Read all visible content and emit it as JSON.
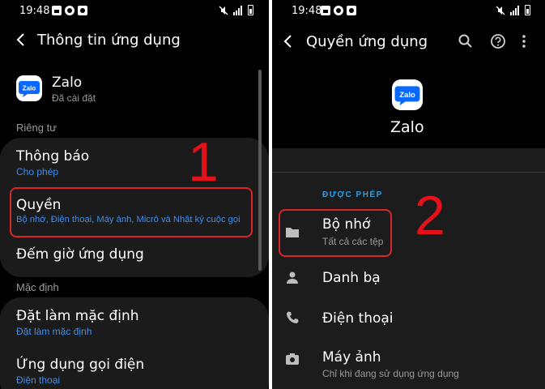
{
  "left": {
    "status": {
      "time": "19:48"
    },
    "app_bar": {
      "title": "Thông tin ứng dụng"
    },
    "app": {
      "icon_text": "Zalo",
      "name": "Zalo",
      "status": "Đã cài đặt"
    },
    "sections": {
      "privacy": "Riêng tư",
      "default": "Mặc định"
    },
    "items": {
      "notifications": {
        "title": "Thông báo",
        "subtitle": "Cho phép"
      },
      "permissions": {
        "title": "Quyền",
        "subtitle": "Bộ nhớ, Điện thoại, Máy ảnh, Micrô và Nhật ký cuộc gọi"
      },
      "screen_time": {
        "title": "Đếm giờ ứng dụng"
      },
      "set_default": {
        "title": "Đặt làm mặc định",
        "subtitle": "Đặt làm mặc định"
      },
      "call_app": {
        "title": "Ứng dụng gọi điện",
        "subtitle": "Điện thoại"
      }
    },
    "step_label": "1"
  },
  "right": {
    "status": {
      "time": "19:48"
    },
    "app_bar": {
      "title": "Quyền ứng dụng"
    },
    "app": {
      "icon_text": "Zalo",
      "name": "Zalo"
    },
    "allowed_header": "ĐƯỢC PHÉP",
    "permissions": [
      {
        "name": "Bộ nhớ",
        "detail": "Tất cả các tệp",
        "icon": "folder-icon"
      },
      {
        "name": "Danh bạ",
        "detail": "",
        "icon": "person-icon"
      },
      {
        "name": "Điện thoại",
        "detail": "",
        "icon": "phone-icon"
      },
      {
        "name": "Máy ảnh",
        "detail": "Chỉ khi đang sử dụng ứng dụng",
        "icon": "camera-icon"
      }
    ],
    "step_label": "2"
  },
  "colors": {
    "accent_blue": "#3d8ef0",
    "highlight_red": "#d8262c",
    "step_red": "#e4111a",
    "card_bg": "#1b1b1b",
    "zalo_blue": "#0a68ff"
  }
}
